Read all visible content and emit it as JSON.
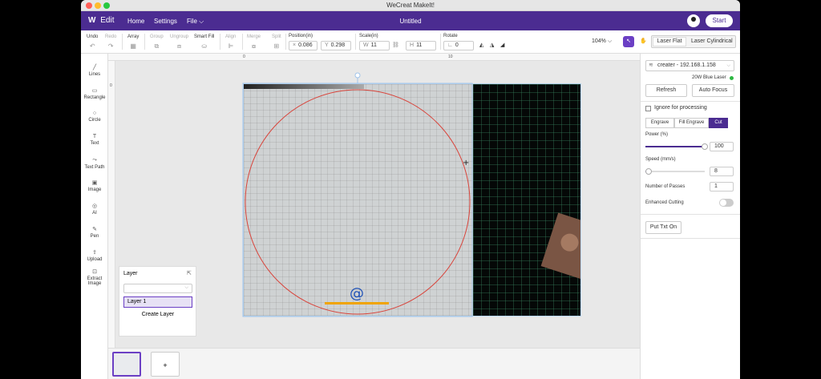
{
  "window": {
    "title": "WeCreat MakeIt!"
  },
  "menu": {
    "brand": "Edit",
    "items": [
      "Home",
      "Settings",
      "File"
    ],
    "file_chevron": "⌵",
    "doc_title": "Untitled",
    "start": "Start"
  },
  "toolbar": {
    "undo": "Undo",
    "redo": "Redo",
    "array": "Array",
    "group": "Group",
    "ungroup": "Ungroup",
    "smart_fill": "Smart Fill",
    "align": "Align",
    "merge": "Merge",
    "split": "Split",
    "position_label": "Position(in)",
    "pos_x_prefix": "×",
    "pos_x": "0.086",
    "pos_y_prefix": "Y",
    "pos_y": "0.298",
    "scale_label": "Scale(in)",
    "scale_w_prefix": "W",
    "scale_w": "11",
    "scale_h_prefix": "H",
    "scale_h": "11",
    "rotate_label": "Rotate",
    "rotate_value": "0",
    "zoom": "104%",
    "mode_flat": "Laser Flat",
    "mode_cyl": "Laser Cylindrical"
  },
  "tools": [
    {
      "label": "Lines",
      "icon": "╱"
    },
    {
      "label": "Rectangle",
      "icon": "▭"
    },
    {
      "label": "Circle",
      "icon": "○"
    },
    {
      "label": "Text",
      "icon": "T"
    },
    {
      "label": "Text Path",
      "icon": "⤳"
    },
    {
      "label": "Image",
      "icon": "▣"
    },
    {
      "label": "AI",
      "icon": "◎"
    },
    {
      "label": "Pen",
      "icon": "✎"
    },
    {
      "label": "Upload",
      "icon": "⇪"
    },
    {
      "label": "Extract Image",
      "icon": "⊡"
    }
  ],
  "ruler": {
    "h": [
      "0",
      "10"
    ],
    "v": [
      "0"
    ]
  },
  "layer_panel": {
    "title": "Layer",
    "layer": "Layer 1",
    "create": "Create Layer"
  },
  "pages": {
    "add": "+"
  },
  "right": {
    "device": "creater - 192.168.1.158",
    "laser": "20W Blue Laser",
    "refresh": "Refresh",
    "autofocus": "Auto Focus",
    "ignore": "Ignore for processing",
    "modes": [
      "Engrave",
      "Fill Engrave",
      "Cut"
    ],
    "power_label": "Power (%)",
    "power": "100",
    "power_level": 1.0,
    "speed_label": "Speed (mm/s)",
    "speed": "8",
    "speed_level": 0.05,
    "passes_label": "Number of Passes",
    "passes": "1",
    "enhanced_label": "Enhanced Cutting",
    "enhanced_on": false,
    "put_text": "Put Txt On"
  },
  "colors": {
    "brand": "#4b2c91",
    "accent": "#6b3fc4",
    "cut_line": "#d9443b",
    "status_ok": "#2db742"
  }
}
